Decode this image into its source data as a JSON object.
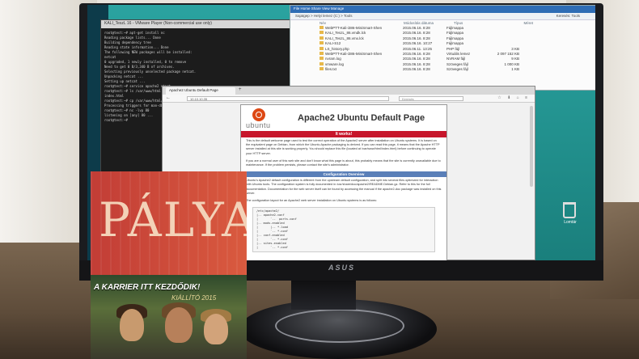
{
  "terminal": {
    "title": "KALI_TeszL 16 - VMware Player (Non-commercial use only)",
    "lines": [
      "root@test:~# apt-get install nc",
      "Reading package lists... Done",
      "Building dependency tree",
      "Reading state information... Done",
      "The following NEW packages will be installed:",
      "  netcat",
      "0 upgraded, 1 newly installed, 0 to remove",
      "Need to get 0 B/3,340 B of archives.",
      "Selecting previously unselected package netcat.",
      "Unpacking netcat ...",
      "Setting up netcat ...",
      "root@test:~# service apache2 start",
      "root@test:~# ls /var/www/html",
      "index.html",
      "root@test:~# cp /var/www/html/index.html ~",
      "Processing triggers for man-db ...",
      "root@test:~# nc -lvp 80",
      "listening on [any] 80 ...",
      "root@test:~#"
    ]
  },
  "explorer": {
    "ribbon": "File   Home   Share   View   Manage",
    "address": "Sajatgep > Helyi lemez (C:) > Tools",
    "search": "Keresés: Tools",
    "headers": [
      "Név",
      "Módosítás dátuma",
      "Típus",
      "Méret"
    ],
    "rows": [
      {
        "name": "WebPTT-Kali-i386-MiniSmart-Shen",
        "date": "2015.06.16. 8:28",
        "type": "Fájlmappa",
        "size": ""
      },
      {
        "name": "KALI_TeszL_86.vmdk.lck",
        "date": "2015.06.16. 8:28",
        "type": "Fájlmappa",
        "size": ""
      },
      {
        "name": "KALI_TeszL_86.vmx.lck",
        "date": "2015.06.16. 8:28",
        "type": "Fájlmappa",
        "size": ""
      },
      {
        "name": "KALI-S12",
        "date": "2015.06.16. 10:27",
        "type": "Fájlmappa",
        "size": ""
      },
      {
        "name": "LS_history.php",
        "date": "2015.06.11. 13:25",
        "type": "PHP fájl",
        "size": "3 KB"
      },
      {
        "name": "WebPTT-Kali-i386-MiniSmart-Shen",
        "date": "2015.06.16. 8:28",
        "type": "Virtuális lemez",
        "size": "2 097 152 KB"
      },
      {
        "name": "nvram.log",
        "date": "2015.06.16. 8:28",
        "type": "NVRAM fájl",
        "size": "9 KB"
      },
      {
        "name": "vmware.log",
        "date": "2015.06.16. 8:28",
        "type": "Szöveges fájl",
        "size": "1 000 KB"
      },
      {
        "name": "files.txt",
        "date": "2015.06.16. 8:28",
        "type": "Szöveges fájl",
        "size": "1 KB"
      }
    ]
  },
  "browser": {
    "tab_label": "Apache2 Ubuntu Default Page",
    "new_tab": "+",
    "url": "10.10.10.35",
    "search_placeholder": "Keresés",
    "nav_icons": "☆ ⬇ ⌂ ≡"
  },
  "page": {
    "logo_word": "ubuntu",
    "title": "Apache2 Ubuntu Default Page",
    "it_works": "It works!",
    "para1": "This is the default welcome page used to test the correct operation of the Apache2 server after installation on Ubuntu systems. It is based on the equivalent page on Debian, from which the Ubuntu Apache packaging is derived. If you can read this page, it means that the Apache HTTP server installed at this site is working properly. You should replace this file (located at /var/www/html/index.html) before continuing to operate your HTTP server.",
    "para2": "If you are a normal user of this web site and don't know what this page is about, this probably means that the site is currently unavailable due to maintenance. If the problem persists, please contact the site's administrator.",
    "config_header": "Configuration Overview",
    "para3": "Ubuntu's Apache2 default configuration is different from the upstream default configuration, and split into several files optimized for interaction with Ubuntu tools. The configuration system is fully documented in /usr/share/doc/apache2/README.Debian.gz. Refer to this for the full documentation. Documentation for the web server itself can be found by accessing the manual if the apache2-doc package was installed on this server.",
    "para4": "The configuration layout for an Apache2 web server installation on Ubuntu systems is as follows:",
    "code": "/etc/apache2/\n|-- apache2.conf\n|       `--  ports.conf\n|-- mods-enabled\n|       |-- *.load\n|       `-- *.conf\n|-- conf-enabled\n|       `-- *.conf\n|-- sites-enabled\n|       `-- *.conf"
  },
  "desktop": {
    "recycle_label": "Lomtár"
  },
  "monitor": {
    "brand": "ASUS"
  },
  "brochure": {
    "title": "PÁLYA",
    "banner": "A KARRIER ITT KEZDŐDIK!",
    "sub": "KIÁLLÍTÓ 2015"
  }
}
